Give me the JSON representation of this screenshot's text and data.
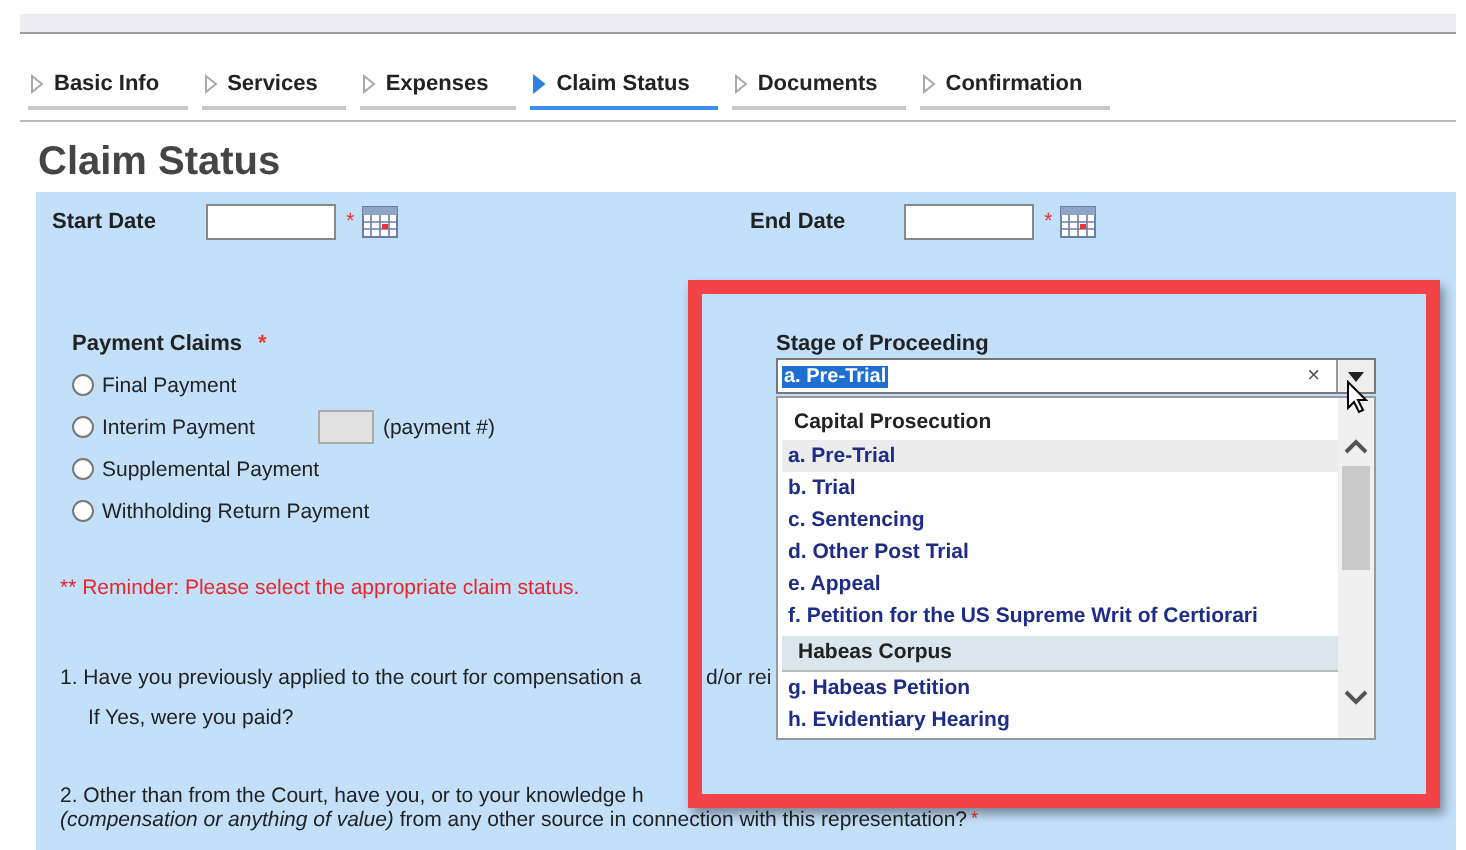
{
  "tabs": [
    {
      "label": "Basic Info",
      "selected": false
    },
    {
      "label": "Services",
      "selected": false
    },
    {
      "label": "Expenses",
      "selected": false
    },
    {
      "label": "Claim Status",
      "selected": true
    },
    {
      "label": "Documents",
      "selected": false
    },
    {
      "label": "Confirmation",
      "selected": false
    }
  ],
  "page_title": "Claim Status",
  "dates": [
    {
      "label": "Start Date",
      "required_mark": "*"
    },
    {
      "label": "End Date",
      "required_mark": "*"
    }
  ],
  "payment_claims": {
    "label": "Payment Claims",
    "required_mark": "*",
    "options": [
      {
        "label": "Final Payment",
        "selected": false
      },
      {
        "label": "Interim Payment",
        "selected": false
      },
      {
        "label": "Supplemental Payment",
        "selected": false
      },
      {
        "label": "Withholding Return Payment",
        "selected": false
      }
    ],
    "payment_number": {
      "label": "(payment #)",
      "disabled": true
    }
  },
  "reminder": "** Reminder: Please select the appropriate claim status.",
  "stage": {
    "label": "Stage of Proceeding",
    "value": "a. Pre-Trial",
    "clear": "×",
    "groups": [
      {
        "heading": "Capital Prosecution",
        "items": [
          {
            "label": "a. Pre-Trial",
            "selected": true
          },
          {
            "label": "b. Trial",
            "selected": false
          },
          {
            "label": "c. Sentencing",
            "selected": false
          },
          {
            "label": "d. Other Post Trial",
            "selected": false
          },
          {
            "label": "e. Appeal",
            "selected": false
          },
          {
            "label": "f. Petition for the US Supreme Writ of Certiorari",
            "selected": false
          }
        ]
      },
      {
        "heading": "Habeas Corpus",
        "items": [
          {
            "label": "g. Habeas Petition",
            "selected": false
          },
          {
            "label": "h. Evidentiary Hearing",
            "selected": false
          }
        ]
      }
    ]
  },
  "questions": [
    {
      "text": "1. Have you previously applied to the court for compensation a",
      "text_continued": "d/or rei",
      "followup": "If Yes, were you paid?"
    },
    {
      "text": "2. Other than from the Court, have you, or to your knowledge h",
      "line_2": "*(compensation or anything of value)* from any other source in connection with this representation?",
      "required_mark": "*"
    }
  ]
}
